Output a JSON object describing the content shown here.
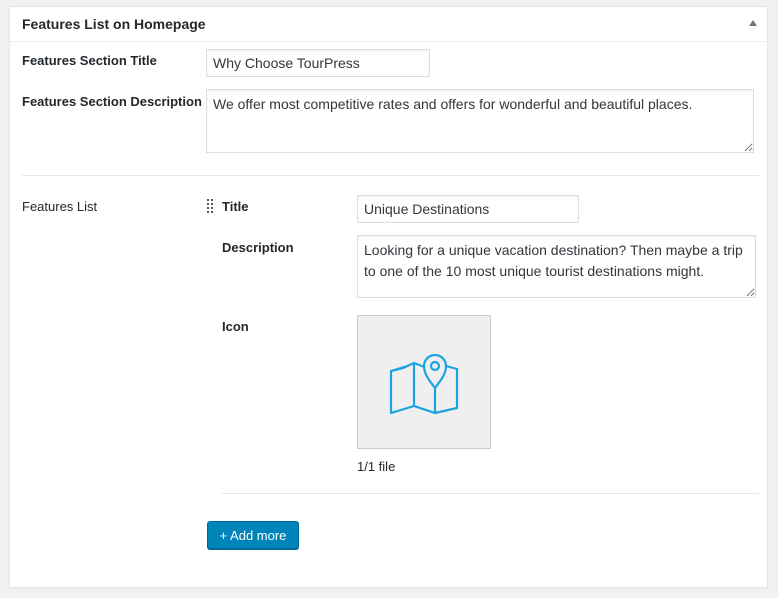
{
  "metabox": {
    "title": "Features List on Homepage",
    "toggle_icon": "triangle-up-icon"
  },
  "section_title": {
    "label": "Features Section Title",
    "value": "Why Choose TourPress"
  },
  "section_description": {
    "label": "Features Section Description",
    "value": "We offer most competitive rates and offers for wonderful and beautiful places."
  },
  "features_list": {
    "label": "Features List",
    "item": {
      "title_label": "Title",
      "title_value": "Unique Destinations",
      "description_label": "Description",
      "description_value": "Looking for a unique vacation destination? Then maybe a trip to one of the 10 most unique tourist destinations might.",
      "icon_label": "Icon",
      "icon_name": "map-pin-icon",
      "icon_color": "#1ba3e0",
      "file_count": "1/1 file"
    },
    "add_more_label": "+ Add more"
  },
  "colors": {
    "button": "#0085ba",
    "background": "#f1f1f1"
  }
}
